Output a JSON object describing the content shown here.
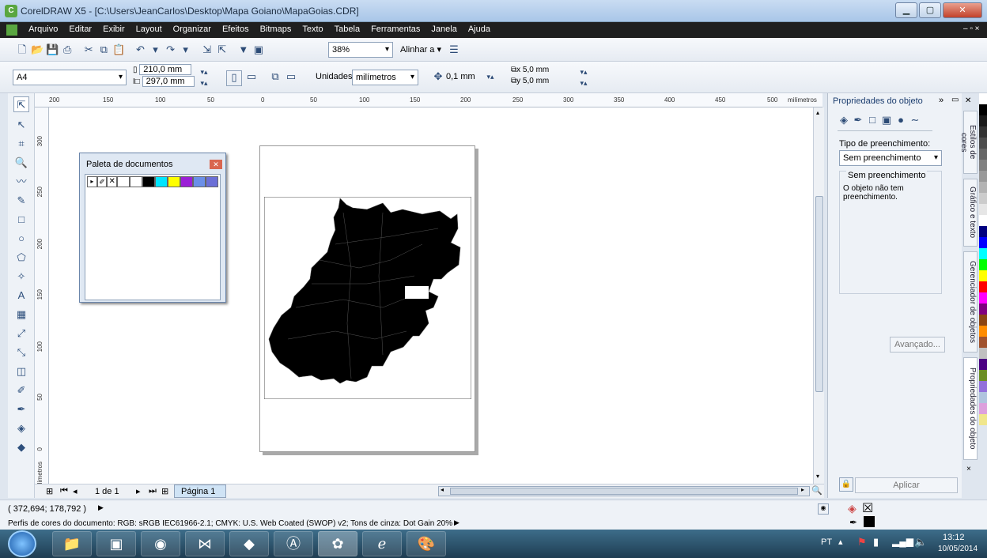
{
  "window": {
    "title": "CorelDRAW X5 - [C:\\Users\\JeanCarlos\\Desktop\\Mapa Goiano\\MapaGoias.CDR]",
    "min_icon": "minimize-icon",
    "max_icon": "maximize-icon",
    "close_icon": "close-icon"
  },
  "menubar": {
    "items": [
      "Arquivo",
      "Editar",
      "Exibir",
      "Layout",
      "Organizar",
      "Efeitos",
      "Bitmaps",
      "Texto",
      "Tabela",
      "Ferramentas",
      "Janela",
      "Ajuda"
    ]
  },
  "toolbar1": {
    "zoom": "38%",
    "align_label": "Alinhar a"
  },
  "toolbar2": {
    "paper_size": "A4",
    "width": "210,0 mm",
    "height": "297,0 mm",
    "units_label": "Unidades:",
    "units_value": "milímetros",
    "nudge": "0,1 mm",
    "dup_x": "5,0 mm",
    "dup_y": "5,0 mm"
  },
  "hruler": {
    "ticks": [
      "200",
      "150",
      "100",
      "50",
      "0",
      "50",
      "100",
      "150",
      "200",
      "250",
      "300",
      "350",
      "400",
      "450",
      "500"
    ],
    "unit": "milímetros"
  },
  "vruler": {
    "ticks": [
      "300",
      "250",
      "200",
      "150",
      "100",
      "50",
      "0"
    ],
    "unit": "milímetros"
  },
  "palette_docker": {
    "title": "Paleta de documentos",
    "swatches": [
      "#ffffff",
      "#ffffff",
      "#000000",
      "#00e5ff",
      "#ffff00",
      "#9b1fd6",
      "#6b8fe8",
      "#6b6fd6"
    ]
  },
  "pager": {
    "count": "1 de 1",
    "page_tab": "Página 1"
  },
  "properties": {
    "title": "Propriedades do objeto",
    "fill_type_label": "Tipo de preenchimento:",
    "fill_type_value": "Sem preenchimento",
    "group_label": "Sem preenchimento",
    "description": "O objeto não tem preenchimento.",
    "advanced_button": "Avançado...",
    "apply_button": "Aplicar"
  },
  "vertical_tabs": [
    "Estilos de cores",
    "Gráfico e texto",
    "Gerenciador de objetos",
    "Propriedades do objeto"
  ],
  "colorbar": [
    "#ffffff",
    "#000000",
    "#1a1a1a",
    "#333333",
    "#4d4d4d",
    "#666666",
    "#808080",
    "#999999",
    "#b3b3b3",
    "#cccccc",
    "#e6e6e6",
    "#ffffff",
    "#000080",
    "#0000ff",
    "#00ffff",
    "#00ff00",
    "#ffff00",
    "#ff0000",
    "#ff00ff",
    "#800080",
    "#8b4513",
    "#ff8c00",
    "#a0522d",
    "#c0c0c0",
    "#4b0082",
    "#6b8e23",
    "#9370db",
    "#b0c4de",
    "#dda0dd",
    "#f0e68c"
  ],
  "status": {
    "coords": "( 372,694; 178,792 )",
    "color_profiles": "Perfis de cores do documento: RGB: sRGB IEC61966-2.1; CMYK: U.S. Web Coated (SWOP) v2; Tons de cinza: Dot Gain 20%"
  },
  "taskbar": {
    "lang": "PT",
    "time": "13:12",
    "date": "10/05/2014"
  }
}
